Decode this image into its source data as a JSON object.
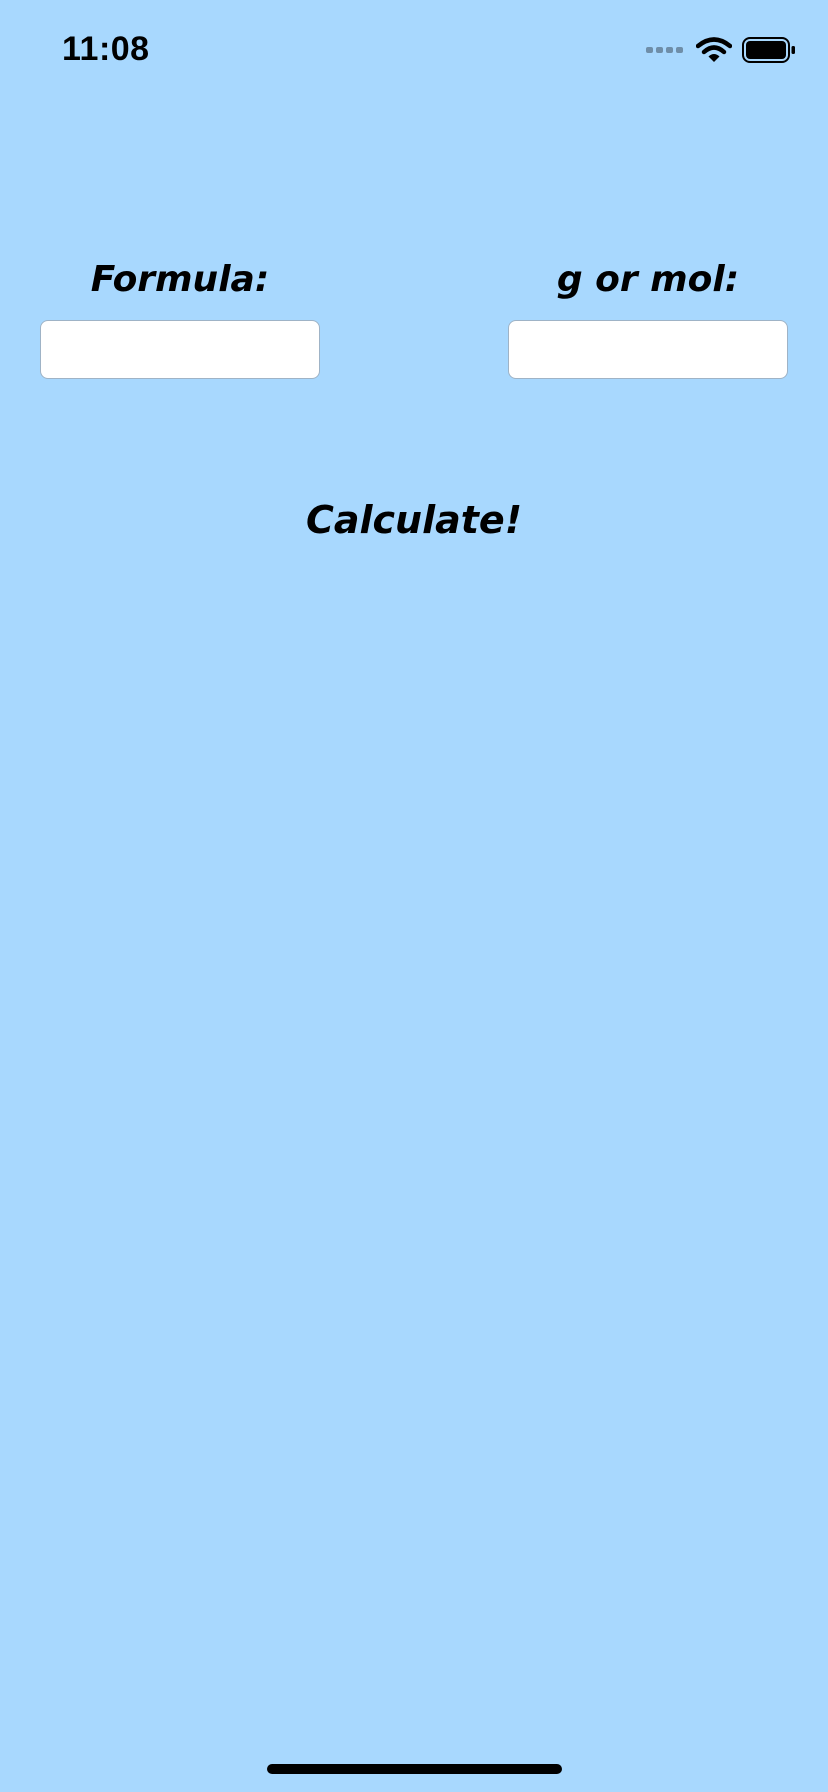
{
  "status_bar": {
    "time": "11:08",
    "signal_icon": "cellular-signal-icon",
    "wifi_icon": "wifi-icon",
    "battery_icon": "battery-icon"
  },
  "form": {
    "formula_label": "Formula:",
    "formula_value": "",
    "amount_label": "g or mol:",
    "amount_value": ""
  },
  "actions": {
    "calculate_label": "Calculate!"
  },
  "colors": {
    "background": "#a8d8fe",
    "field_background": "#ffffff",
    "text": "#000000"
  }
}
